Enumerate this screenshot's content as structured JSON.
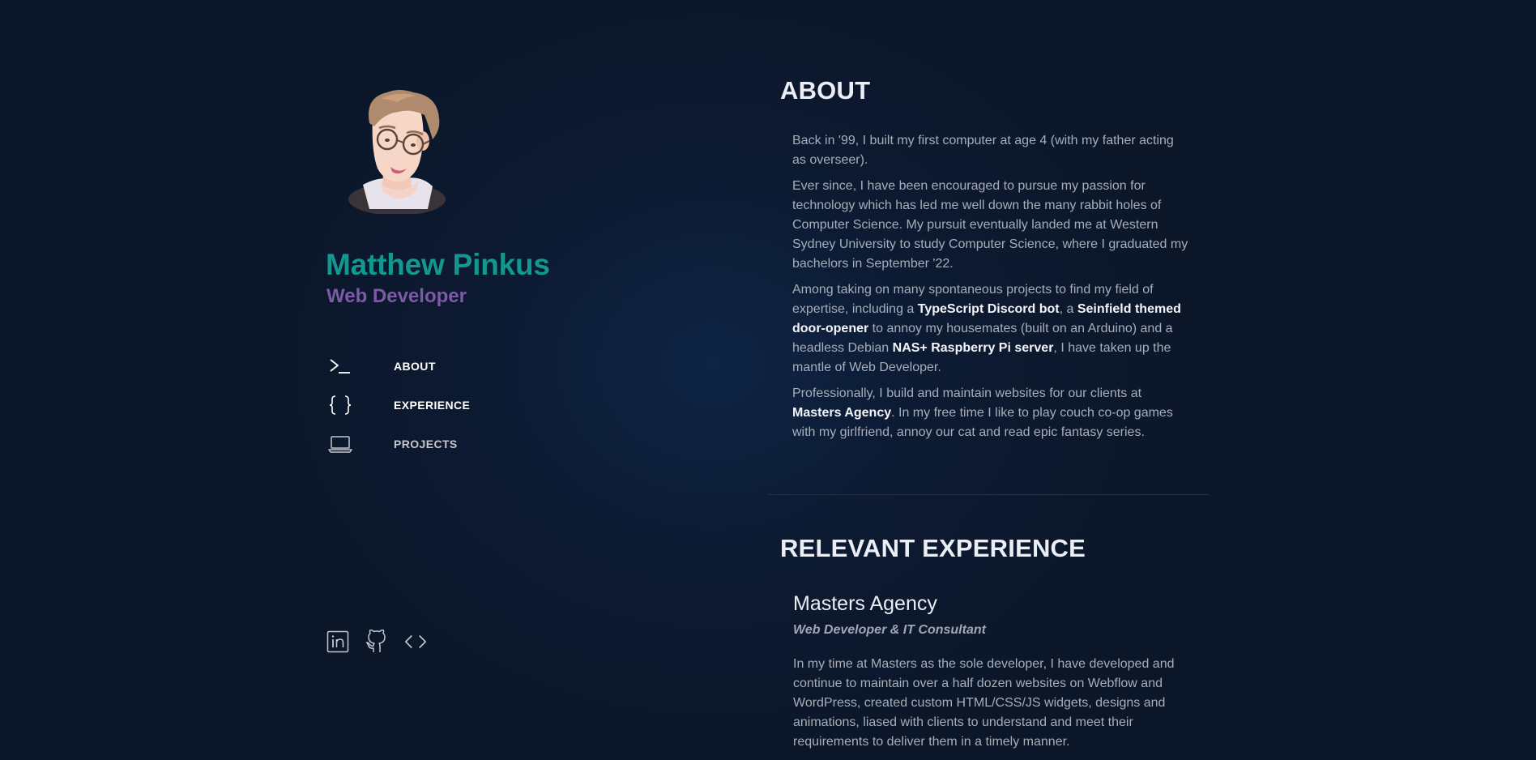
{
  "profile": {
    "name": "Matthew Pinkus",
    "role": "Web Developer"
  },
  "nav": [
    {
      "label": "ABOUT",
      "icon": "terminal-icon",
      "active": true
    },
    {
      "label": "EXPERIENCE",
      "icon": "curly-braces-icon",
      "active": true
    },
    {
      "label": "PROJECTS",
      "icon": "laptop-icon",
      "active": false
    }
  ],
  "socials": [
    {
      "icon": "linkedin-icon"
    },
    {
      "icon": "github-icon"
    },
    {
      "icon": "code-icon"
    }
  ],
  "about": {
    "heading": "ABOUT",
    "p1": "Back in '99, I built my first computer at age 4 (with my father acting as overseer).",
    "p2": "Ever since, I have been encouraged to pursue my passion for technology which has led me well down the many rabbit holes of Computer Science. My pursuit eventually landed me at Western Sydney University to study Computer Science, where I graduated my bachelors in September '22.",
    "p3_a": "Among taking on many spontaneous projects to find my field of expertise, including a ",
    "p3_b": "TypeScript Discord bot",
    "p3_c": ", a ",
    "p3_d": "Seinfield themed door-opener",
    "p3_e": " to annoy my housemates (built on an Arduino) and a headless Debian ",
    "p3_f": "NAS+ Raspberry Pi server",
    "p3_g": ", I have taken up the mantle of Web Developer.",
    "p4_a": "Professionally, I build and maintain websites for our clients at ",
    "p4_b": "Masters Agency",
    "p4_c": ". In my free time I like to play couch co-op games with my girlfriend, annoy our cat and read epic fantasy series."
  },
  "experience": {
    "heading": "RELEVANT EXPERIENCE",
    "company": "Masters Agency",
    "title": "Web Developer & IT Consultant",
    "description": "In my time at Masters as the sole developer, I have developed and continue to maintain over a half dozen websites on Webflow and WordPress, created custom HTML/CSS/JS widgets, designs and animations, liased with clients to understand and meet their requirements to deliver them in a timely manner."
  },
  "colors": {
    "name": "#13978f",
    "role": "#7c5aa6",
    "background": "#0b1628"
  }
}
